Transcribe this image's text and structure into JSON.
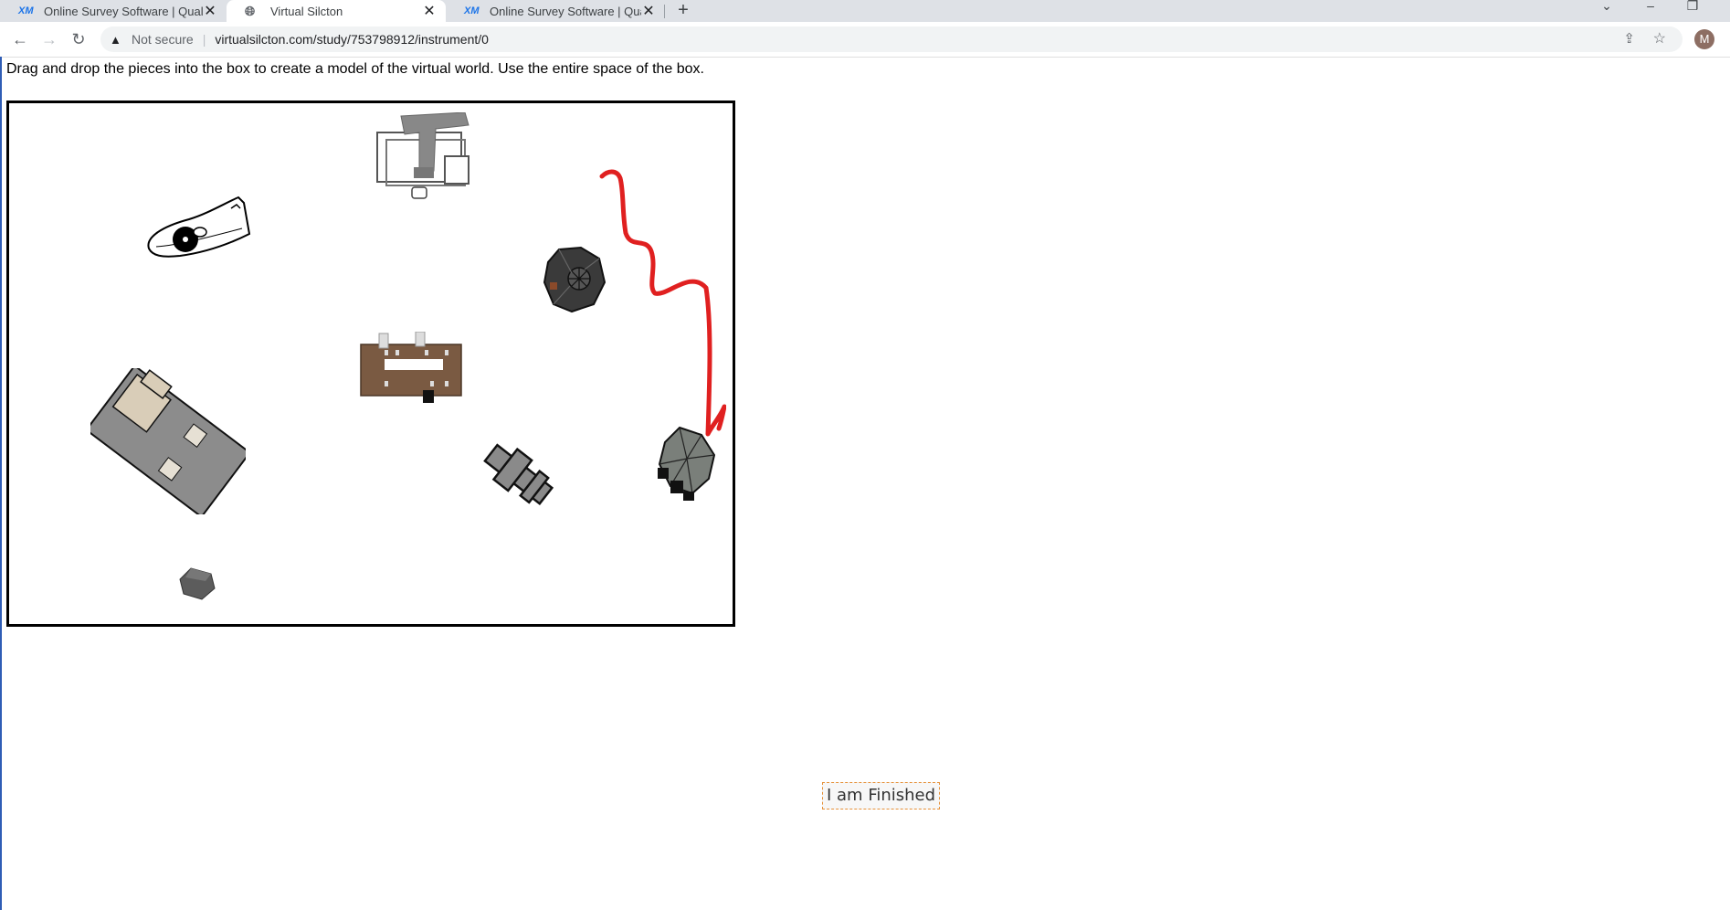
{
  "browser": {
    "tabs": [
      {
        "label": "Online Survey Software | Qualtrics",
        "favicon": "XM",
        "active": false
      },
      {
        "label": "Virtual Silcton",
        "favicon": "globe-icon",
        "active": true
      },
      {
        "label": "Online Survey Software | Qualtrics",
        "favicon": "XM",
        "active": false
      }
    ],
    "new_tab": "+",
    "address": {
      "security_label": "Not secure",
      "url": "virtualsilcton.com/study/753798912/instrument/0"
    },
    "avatar_initial": "M"
  },
  "page": {
    "instruction": "Drag and drop the pieces into the box to create a model of the virtual world. Use the entire space of the box.",
    "finish_button": "I am Finished"
  },
  "colors": {
    "path_stroke": "#e02020",
    "button_border": "#e69138",
    "tab_bg": "#dee1e6"
  }
}
